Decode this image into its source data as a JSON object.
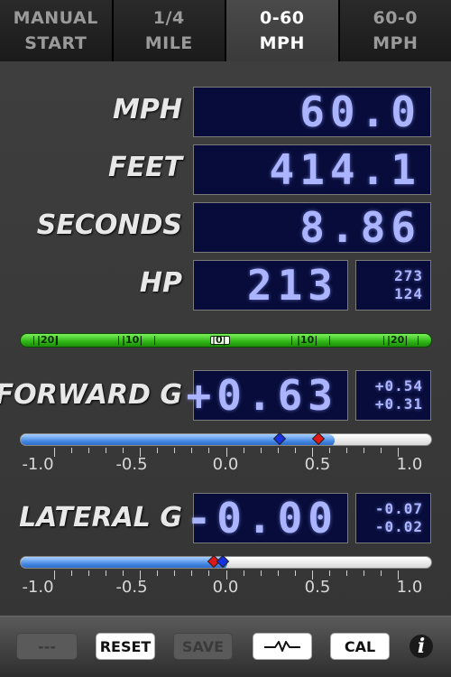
{
  "tabs": [
    {
      "line1": "MANUAL",
      "line2": "START",
      "active": false
    },
    {
      "line1": "1/4",
      "line2": "MILE",
      "active": false
    },
    {
      "line1": "0-60",
      "line2": "MPH",
      "active": true
    },
    {
      "line1": "60-0",
      "line2": "MPH",
      "active": false
    }
  ],
  "readouts": {
    "mph": {
      "label": "MPH",
      "value": "60.0"
    },
    "feet": {
      "label": "FEET",
      "value": "414.1"
    },
    "seconds": {
      "label": "SECONDS",
      "value": "8.86"
    },
    "hp": {
      "label": "HP",
      "value": "213",
      "top": "273",
      "bottom": "124"
    }
  },
  "balance_scale": {
    "left20": "|20|",
    "left10": "|10|",
    "center": "|0|",
    "right10": "|10|",
    "right20": "|20|"
  },
  "forward_g": {
    "label": "FORWARD G",
    "value": "+0.63",
    "max": "+0.54",
    "min": "+0.31",
    "fill_value": 0.63,
    "blue_marker": 0.31,
    "red_marker": 0.54
  },
  "lateral_g": {
    "label": "LATERAL G",
    "value": "-0.00",
    "max": "-0.07",
    "min": "-0.02",
    "fill_value": 0.0,
    "blue_marker": -0.02,
    "red_marker": -0.07
  },
  "g_scale": [
    "-1.0",
    "-0.5",
    "0.0",
    "0.5",
    "1.0"
  ],
  "toolbar": {
    "dash_label": "---",
    "reset_label": "RESET",
    "save_label": "SAVE",
    "cal_label": "CAL",
    "info_label": "i",
    "graph_icon": "waveform-icon"
  },
  "colors": {
    "lcd_bg": "#070c3a",
    "lcd_text": "#aab4ff",
    "accent_blue": "#3d82e0",
    "marker_red": "#e01818",
    "marker_blue": "#1830e0"
  }
}
